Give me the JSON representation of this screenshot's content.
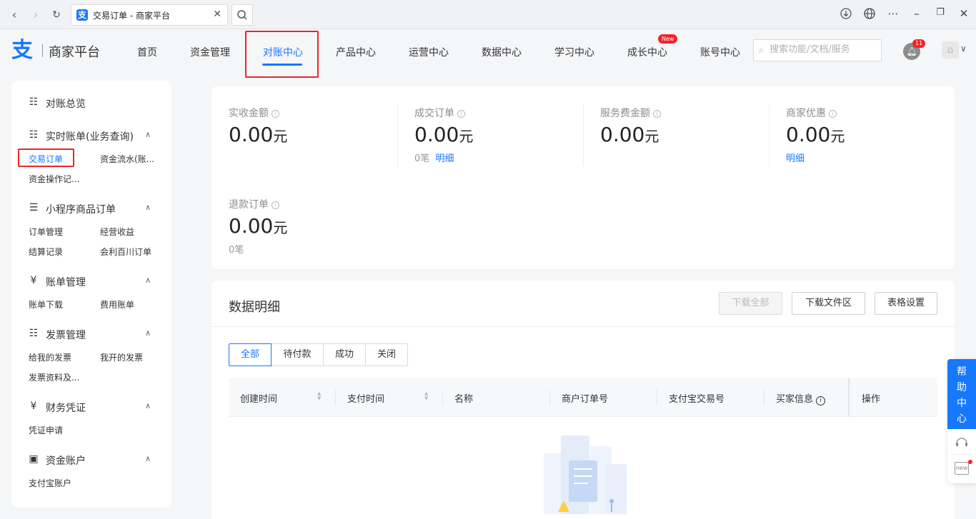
{
  "browser": {
    "tab_title": "交易订单 - 商家平台",
    "favicon_char": "支"
  },
  "header": {
    "logo_text": "商家平台",
    "nav": [
      {
        "label": "首页"
      },
      {
        "label": "资金管理"
      },
      {
        "label": "对账中心",
        "active": true
      },
      {
        "label": "产品中心"
      },
      {
        "label": "运营中心"
      },
      {
        "label": "数据中心"
      },
      {
        "label": "学习中心"
      },
      {
        "label": "成长中心",
        "badge": "New"
      },
      {
        "label": "账号中心"
      }
    ],
    "search_placeholder": "搜索功能/文档/服务",
    "notification_count": "11"
  },
  "sidebar": {
    "overview": "对账总览",
    "groups": [
      {
        "title": "实时账单(业务查询)",
        "items": [
          "交易订单",
          "资金流水(账...",
          "资金操作记..."
        ]
      },
      {
        "title": "小程序商品订单",
        "items": [
          "订单管理",
          "经营收益",
          "结算记录",
          "会利百川订单"
        ]
      },
      {
        "title": "账单管理",
        "items": [
          "账单下载",
          "费用账单"
        ]
      },
      {
        "title": "发票管理",
        "items": [
          "给我的发票",
          "我开的发票",
          "发票资料及..."
        ]
      },
      {
        "title": "财务凭证",
        "items": [
          "凭证申请"
        ]
      },
      {
        "title": "资金账户",
        "items": [
          "支付宝账户"
        ]
      }
    ]
  },
  "summary": {
    "metrics": [
      {
        "label": "实收金额",
        "value": "0.00",
        "unit": "元"
      },
      {
        "label": "成交订单",
        "value": "0.00",
        "unit": "元",
        "sub_count": "0笔",
        "sub_link": "明细"
      },
      {
        "label": "服务费金额",
        "value": "0.00",
        "unit": "元"
      },
      {
        "label": "商家优惠",
        "value": "0.00",
        "unit": "元",
        "sub_link": "明细"
      },
      {
        "label": "退款订单",
        "value": "0.00",
        "unit": "元",
        "sub_count": "0笔"
      }
    ]
  },
  "details": {
    "title": "数据明细",
    "buttons": {
      "download_all": "下载全部",
      "download_area": "下载文件区",
      "table_settings": "表格设置"
    },
    "filters": [
      "全部",
      "待付款",
      "成功",
      "关闭"
    ],
    "columns": [
      "创建时间",
      "支付时间",
      "名称",
      "商户订单号",
      "支付宝交易号",
      "买家信息",
      "操作"
    ]
  },
  "help": {
    "label_chars": [
      "帮",
      "助",
      "中",
      "心"
    ],
    "new_label": "new"
  },
  "colors": {
    "accent": "#1677ff",
    "highlight_box": "#e82727",
    "badge": "#f5222d"
  }
}
